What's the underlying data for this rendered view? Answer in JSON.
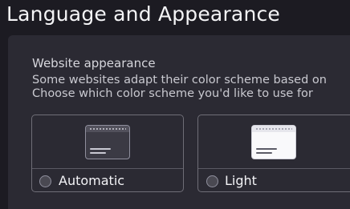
{
  "page": {
    "title": "Language and Appearance"
  },
  "website_appearance": {
    "title": "Website appearance",
    "description_line1": "Some websites adapt their color scheme based on",
    "description_line2": "Choose which color scheme you'd like to use for"
  },
  "theme_options": [
    {
      "label": "Automatic",
      "selected": false
    },
    {
      "label": "Light",
      "selected": false
    }
  ],
  "colors": {
    "background": "#1c1b22",
    "section_background": "#2b2a33",
    "card_border": "#6f6e77",
    "text": "#f3f3f6"
  }
}
